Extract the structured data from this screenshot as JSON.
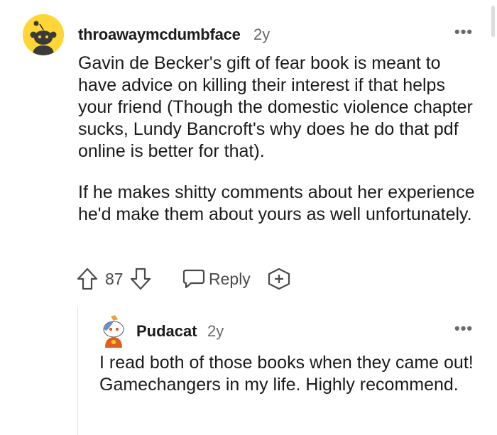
{
  "comment": {
    "username": "throawaymcdumbface",
    "age": "2y",
    "paragraphs": [
      "Gavin de Becker's gift of fear book is meant to have advice on killing their interest if that helps your friend (Though the domestic violence chapter sucks, Lundy Bancroft's why does he do that pdf online is better for that).",
      "If he makes shitty comments about her experience he'd make them about yours as well unfortunately."
    ],
    "votes": "87",
    "reply_label": "Reply",
    "more_label": "•••"
  },
  "reply": {
    "username": "Pudacat",
    "age": "2y",
    "text": "I read both of those books when they came out! Gamechangers in my life. Highly recommend.",
    "more_label": "•••"
  },
  "colors": {
    "avatar_bg": "#ffd635",
    "text": "#1a1a1b",
    "muted": "#6a6a6a"
  }
}
